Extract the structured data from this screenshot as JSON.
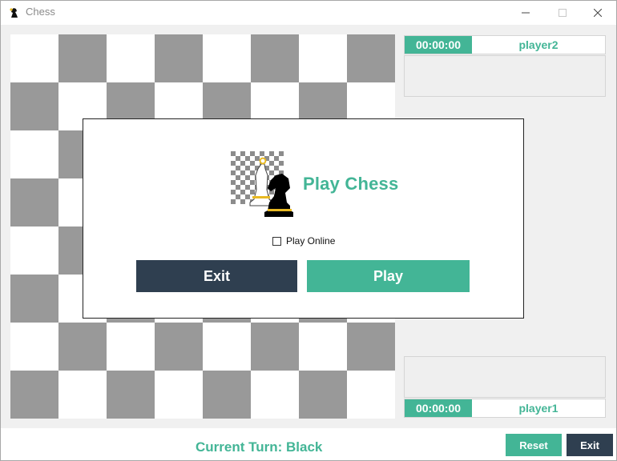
{
  "window": {
    "title": "Chess",
    "icon": "chess-knight-icon",
    "controls": [
      "minimize-icon",
      "maximize-icon",
      "close-icon"
    ]
  },
  "board": {
    "size": 8,
    "light_color": "#ffffff",
    "dark_color": "#999999"
  },
  "players": {
    "top": {
      "timer": "00:00:00",
      "name": "player2"
    },
    "bottom": {
      "timer": "00:00:00",
      "name": "player1"
    }
  },
  "status": {
    "turn": "Current Turn: Black"
  },
  "toolbar": {
    "reset_label": "Reset",
    "exit_label": "Exit"
  },
  "dialog": {
    "title": "Play Chess",
    "online_label": "Play Online",
    "online_checked": false,
    "exit_label": "Exit",
    "play_label": "Play"
  },
  "colors": {
    "accent": "#43b596",
    "dark": "#2f3f50"
  }
}
